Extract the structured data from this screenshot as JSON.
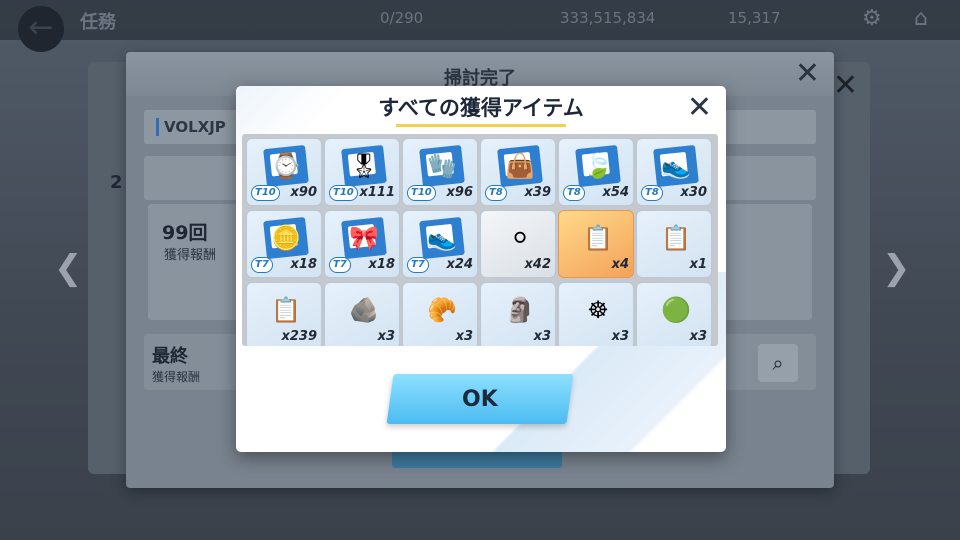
{
  "topbar": {
    "title": "任務",
    "stamina": "0/290",
    "credits": "333,515,834",
    "gems": "15,317"
  },
  "background": {
    "mid_modal": {
      "title": "掃討完了",
      "stage_code": "VOLXJP",
      "partial_number": "2",
      "sweep_count": "99回",
      "reward_label": "獲得報酬",
      "final_title": "最終",
      "final_label": "獲得報酬"
    }
  },
  "dialog": {
    "title": "すべての獲得アイテム",
    "ok_label": "OK",
    "items": [
      {
        "name": "t10-watch",
        "tier": "T10",
        "qty": "x90",
        "glyph": "⌚",
        "style": "doc"
      },
      {
        "name": "t10-badge",
        "tier": "T10",
        "qty": "x111",
        "glyph": "🎖",
        "style": "doc"
      },
      {
        "name": "t10-gloves",
        "tier": "T10",
        "qty": "x96",
        "glyph": "🧤",
        "style": "doc"
      },
      {
        "name": "t8-bag",
        "tier": "T8",
        "qty": "x39",
        "glyph": "👜",
        "style": "doc"
      },
      {
        "name": "t8-hairpin",
        "tier": "T8",
        "qty": "x54",
        "glyph": "🍃",
        "style": "doc"
      },
      {
        "name": "t8-shoes",
        "tier": "T8",
        "qty": "x30",
        "glyph": "👟",
        "style": "doc"
      },
      {
        "name": "t7-charm",
        "tier": "T7",
        "qty": "x18",
        "glyph": "🪙",
        "style": "doc"
      },
      {
        "name": "t7-hairband",
        "tier": "T7",
        "qty": "x18",
        "glyph": "🎀",
        "style": "doc"
      },
      {
        "name": "t7-shoes",
        "tier": "T7",
        "qty": "x24",
        "glyph": "👟",
        "style": "doc"
      },
      {
        "name": "silver-orb",
        "tier": "",
        "qty": "x42",
        "glyph": "⚪",
        "style": "silver"
      },
      {
        "name": "report-orange",
        "tier": "",
        "qty": "x4",
        "glyph": "📋",
        "style": "orange"
      },
      {
        "name": "report-blue",
        "tier": "",
        "qty": "x1",
        "glyph": "📋",
        "style": "plain"
      },
      {
        "name": "report-basic",
        "tier": "",
        "qty": "x239",
        "glyph": "📋",
        "style": "plain"
      },
      {
        "name": "stone-shell",
        "tier": "",
        "qty": "x3",
        "glyph": "🪨",
        "style": "plain"
      },
      {
        "name": "gold-piece",
        "tier": "",
        "qty": "x3",
        "glyph": "🥐",
        "style": "plain"
      },
      {
        "name": "totem-piece",
        "tier": "",
        "qty": "x3",
        "glyph": "🗿",
        "style": "plain"
      },
      {
        "name": "golden-wheel",
        "tier": "",
        "qty": "x3",
        "glyph": "☸",
        "style": "plain"
      },
      {
        "name": "green-beads",
        "tier": "",
        "qty": "x3",
        "glyph": "🟢",
        "style": "plain"
      }
    ]
  }
}
